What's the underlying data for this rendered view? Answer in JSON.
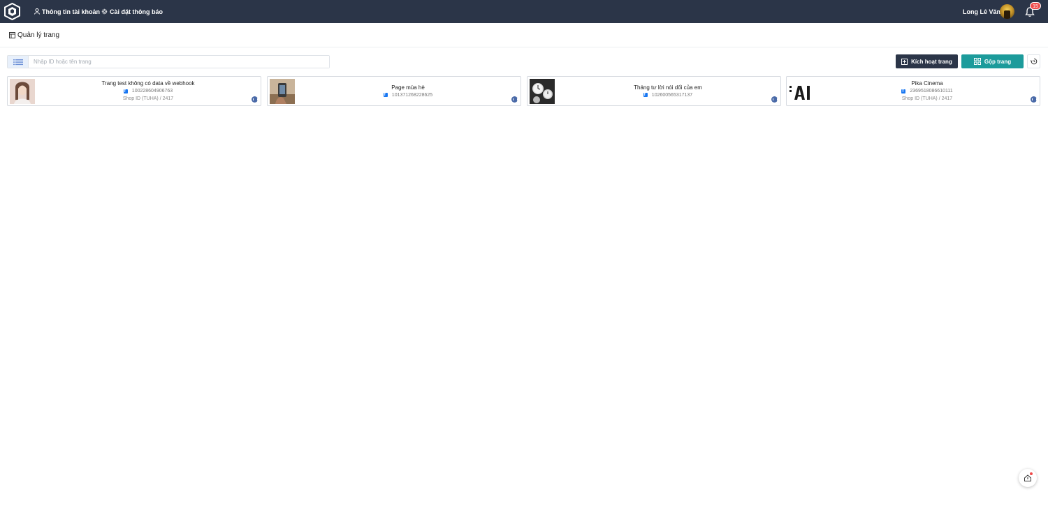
{
  "topbar": {
    "nav": [
      {
        "label": "Thông tin tài khoản",
        "icon": "user-icon"
      },
      {
        "label": "Cài đặt thông báo",
        "icon": "gear-icon"
      }
    ],
    "user_name": "Long Lê Văn",
    "notification_count": "15"
  },
  "page": {
    "title": "Quản lý trang"
  },
  "search": {
    "placeholder": "Nhập ID hoặc tên trang",
    "value": ""
  },
  "actions": {
    "activate_label": "Kích hoạt trang",
    "merge_label": "Gộp trang"
  },
  "colors": {
    "topbar": "#2b3548",
    "merge_button": "#1c9b9b",
    "badge": "#ef4a4a"
  },
  "pages": [
    {
      "name": "Trang test không có data về webhook",
      "id": "100228604906763",
      "shop": "Shop ID (TUHA) / 2417"
    },
    {
      "name": "Page mùa hè",
      "id": "101371268228625",
      "shop": ""
    },
    {
      "name": "Tháng tư lời nói dối của em",
      "id": "102600565317137",
      "shop": ""
    },
    {
      "name": "Pika Cinema",
      "id": "2369518086610111",
      "shop": "Shop ID (TUHA) / 2417"
    }
  ]
}
